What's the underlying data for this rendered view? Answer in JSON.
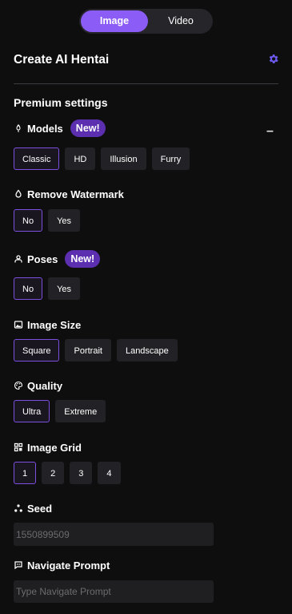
{
  "toggle": {
    "image": "Image",
    "video": "Video"
  },
  "header": {
    "title": "Create AI Hentai"
  },
  "premium_label": "Premium settings",
  "sections": {
    "models": {
      "label": "Models",
      "badge": "New!",
      "collapse": "–",
      "options": [
        "Classic",
        "HD",
        "Illusion",
        "Furry"
      ],
      "selected": "Classic"
    },
    "watermark": {
      "label": "Remove Watermark",
      "options": [
        "No",
        "Yes"
      ],
      "selected": "No"
    },
    "poses": {
      "label": "Poses",
      "badge": "New!",
      "options": [
        "No",
        "Yes"
      ],
      "selected": "No"
    },
    "size": {
      "label": "Image Size",
      "options": [
        "Square",
        "Portrait",
        "Landscape"
      ],
      "selected": "Square"
    },
    "quality": {
      "label": "Quality",
      "options": [
        "Ultra",
        "Extreme"
      ],
      "selected": "Ultra"
    },
    "grid": {
      "label": "Image Grid",
      "options": [
        "1",
        "2",
        "3",
        "4"
      ],
      "selected": "1"
    },
    "seed": {
      "label": "Seed",
      "placeholder": "1550899509"
    },
    "navigate": {
      "label": "Navigate Prompt",
      "placeholder": "Type Navigate Prompt"
    }
  },
  "colors": {
    "accent": "#8b5cf6",
    "badge": "#5b2fb0",
    "background": "#0e0e0f"
  }
}
